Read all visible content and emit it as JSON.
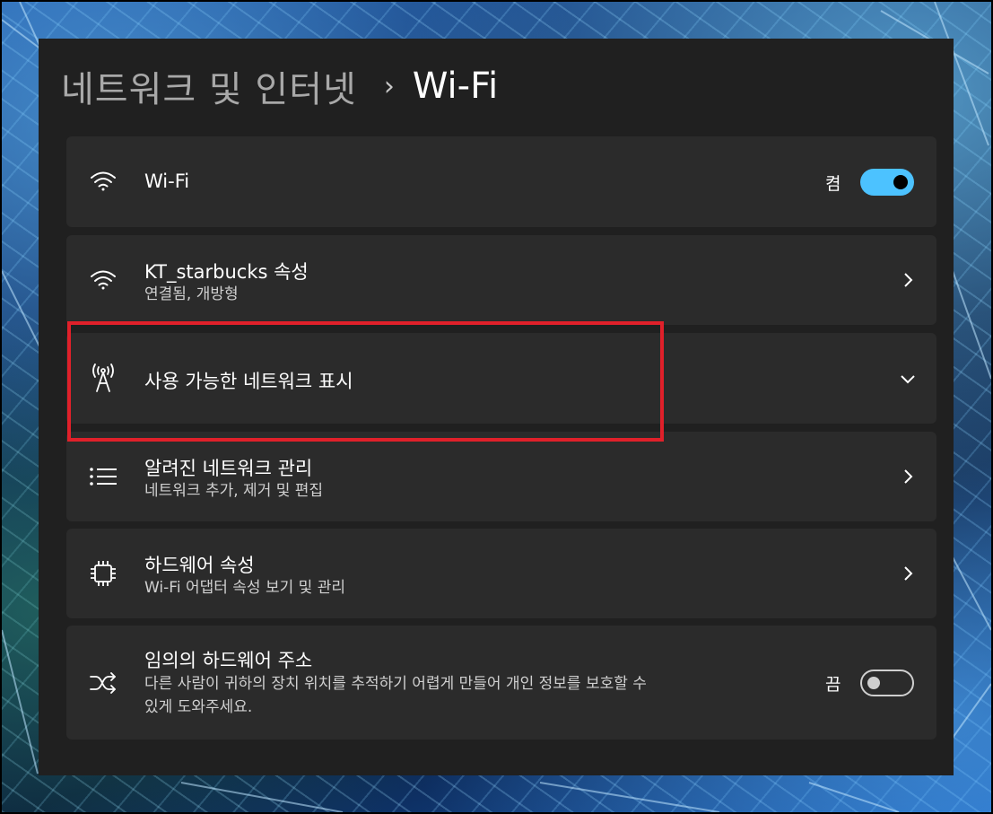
{
  "breadcrumb": {
    "parent": "네트워크 및 인터넷",
    "separator": "›",
    "current": "Wi-Fi"
  },
  "wifi_toggle": {
    "title": "Wi-Fi",
    "state_label": "켬",
    "on": true,
    "icon": "wifi-icon"
  },
  "network_properties": {
    "title": "KT_starbucks 속성",
    "subtitle": "연결됨, 개방형",
    "icon": "wifi-icon"
  },
  "available_networks": {
    "title": "사용 가능한 네트워크 표시",
    "icon": "antenna-icon"
  },
  "known_networks": {
    "title": "알려진 네트워크 관리",
    "subtitle": "네트워크 추가, 제거 및 편집",
    "icon": "list-icon"
  },
  "hardware_properties": {
    "title": "하드웨어 속성",
    "subtitle": "Wi-Fi 어댑터 속성 보기 및 관리",
    "icon": "chip-icon"
  },
  "random_hw_address": {
    "title": "임의의 하드웨어 주소",
    "subtitle_line1": "다른 사람이 귀하의 장치 위치를 추적하기 어렵게 만들어 개인 정보를 보호할 수",
    "subtitle_line2": "있게 도와주세요.",
    "state_label": "끔",
    "on": false,
    "icon": "shuffle-icon"
  },
  "colors": {
    "accent": "#4cc2ff",
    "highlight_box": "#e0202a",
    "window_bg": "#202020",
    "card_bg": "#2b2b2b"
  }
}
